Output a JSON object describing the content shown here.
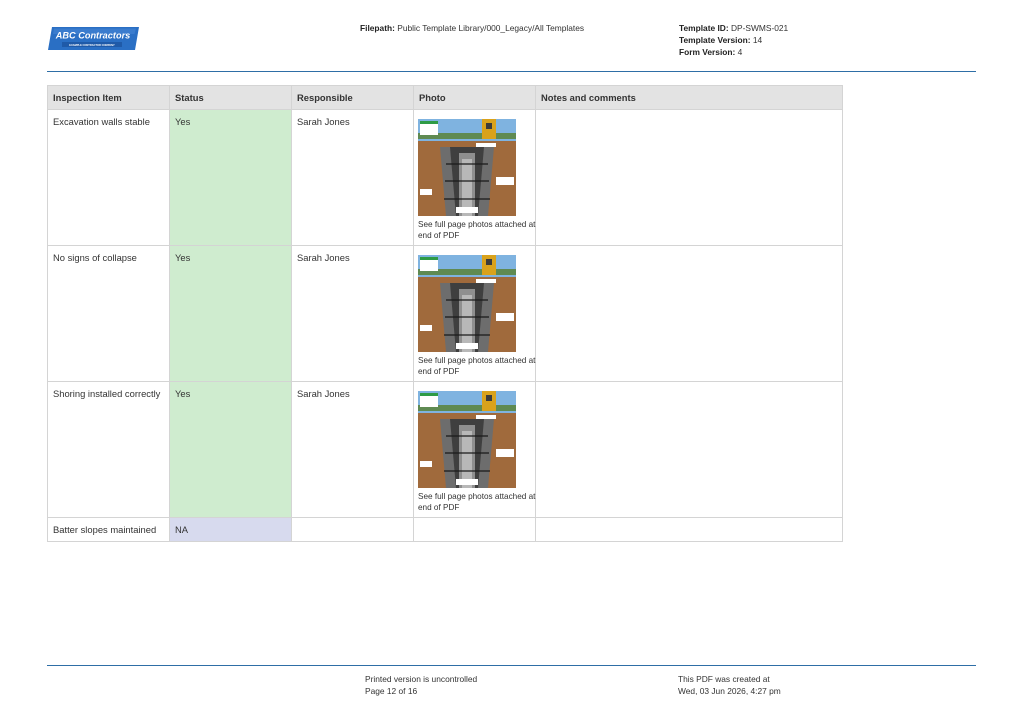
{
  "header": {
    "logo_text": "ABC Contractors",
    "logo_subtext": "EXAMPLE CONTRACTOR COMPANY",
    "filepath_label": "Filepath:",
    "filepath_value": "Public Template Library/000_Legacy/All Templates",
    "template_id_label": "Template ID:",
    "template_id_value": "DP-SWMS-021",
    "template_version_label": "Template Version:",
    "template_version_value": "14",
    "form_version_label": "Form Version:",
    "form_version_value": "4"
  },
  "table": {
    "columns": [
      "Inspection Item",
      "Status",
      "Responsible",
      "Photo",
      "Notes and comments"
    ],
    "rows": [
      {
        "item": "Excavation walls stable",
        "status": "Yes",
        "responsible": "Sarah Jones",
        "photo_note": "See full page photos attached at end of PDF",
        "notes": ""
      },
      {
        "item": "No signs of collapse",
        "status": "Yes",
        "responsible": "Sarah Jones",
        "photo_note": "See full page photos attached at end of PDF",
        "notes": ""
      },
      {
        "item": "Shoring installed correctly",
        "status": "Yes",
        "responsible": "Sarah Jones",
        "photo_note": "See full page photos attached at end of PDF",
        "notes": ""
      },
      {
        "item": "Batter slopes maintained",
        "status": "NA",
        "responsible": "",
        "photo_note": "",
        "notes": ""
      }
    ]
  },
  "footer": {
    "uncontrolled": "Printed version is uncontrolled",
    "page": "Page 12 of 16",
    "created_label": "This PDF was created at",
    "created_value": "Wed, 03 Jun 2026, 4:27 pm"
  },
  "colors": {
    "rule": "#2e6ea6",
    "status_yes": "#cfeccf",
    "status_na": "#d7daee",
    "header_row": "#e3e3e3",
    "logo_blue": "#2a6fc4"
  }
}
